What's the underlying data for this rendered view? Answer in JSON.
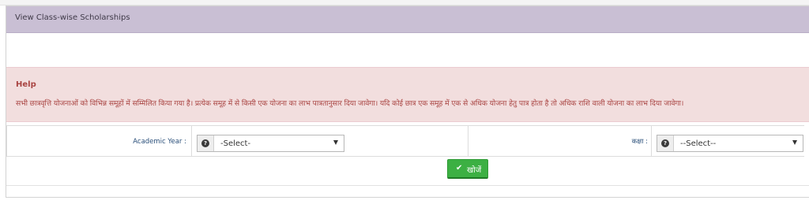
{
  "panel": {
    "title": "View Class-wise Scholarships"
  },
  "help": {
    "title": "Help",
    "text": "सभी छात्रवृत्ति योजनाओं को विभिन्न समूहों में सम्मिलित किया गया है। प्रत्येक समूह में से किसी एक योजना का लाभ पात्रतानुसार दिया जावेगा। यदि कोई छात्र एक समूह में एक से अधिक योजना हेतु पात्र होता है तो अधिक राशि वाली योजना का लाभ दिया जावेगा।"
  },
  "form": {
    "academic_year": {
      "label": "Academic Year :",
      "selected": "-Select-",
      "icon": "question-circle-icon"
    },
    "class": {
      "label": "कक्षा :",
      "selected": "--Select--",
      "icon": "question-circle-icon"
    }
  },
  "actions": {
    "search_label": "खोजें",
    "search_icon": "check-icon",
    "button_color": "#3cb043"
  }
}
